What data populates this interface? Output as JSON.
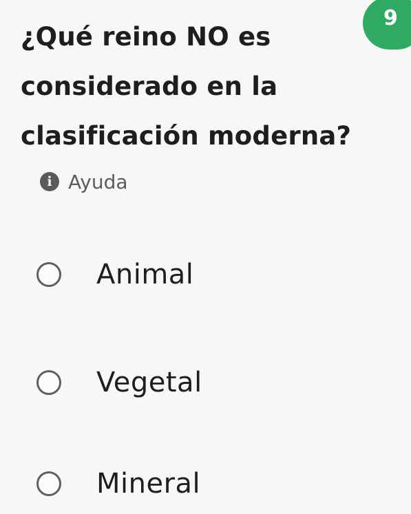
{
  "question": {
    "text": "¿Qué reino NO es considerado en la clasificación moderna?",
    "number": "9"
  },
  "help": {
    "label": "Ayuda",
    "icon": "info-icon"
  },
  "options": [
    {
      "label": "Animal",
      "selected": false
    },
    {
      "label": "Vegetal",
      "selected": false
    },
    {
      "label": "Mineral",
      "selected": false
    }
  ],
  "colors": {
    "background": "#f7f7f7",
    "badge": "#2eaa63",
    "text": "#1e1e1e",
    "muted": "#5c5c5c"
  }
}
